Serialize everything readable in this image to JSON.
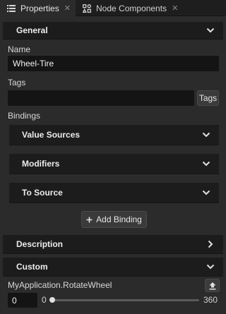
{
  "tabs": [
    {
      "label": "Properties",
      "icon": "list-icon",
      "active": true
    },
    {
      "label": "Node Components",
      "icon": "node-components-icon",
      "active": false
    }
  ],
  "general": {
    "title": "General",
    "name_label": "Name",
    "name_value": "Wheel-Tire",
    "tags_label": "Tags",
    "tags_value": "",
    "tags_button": "Tags",
    "bindings_label": "Bindings",
    "bindings": [
      {
        "title": "Value Sources"
      },
      {
        "title": "Modifiers"
      },
      {
        "title": "To Source"
      }
    ],
    "add_binding_label": "Add Binding",
    "add_binding_icon": "plus-icon"
  },
  "description": {
    "title": "Description"
  },
  "custom": {
    "title": "Custom",
    "property_label": "MyApplication.RotateWheel",
    "value": "0",
    "slider_min": "0",
    "slider_max": "360",
    "slider_fraction": 0,
    "publish_icon": "upload-icon"
  },
  "colors": {
    "panel_bg": "#2b2b2b",
    "header_bg": "#1c1c1c",
    "input_bg": "#141414"
  }
}
